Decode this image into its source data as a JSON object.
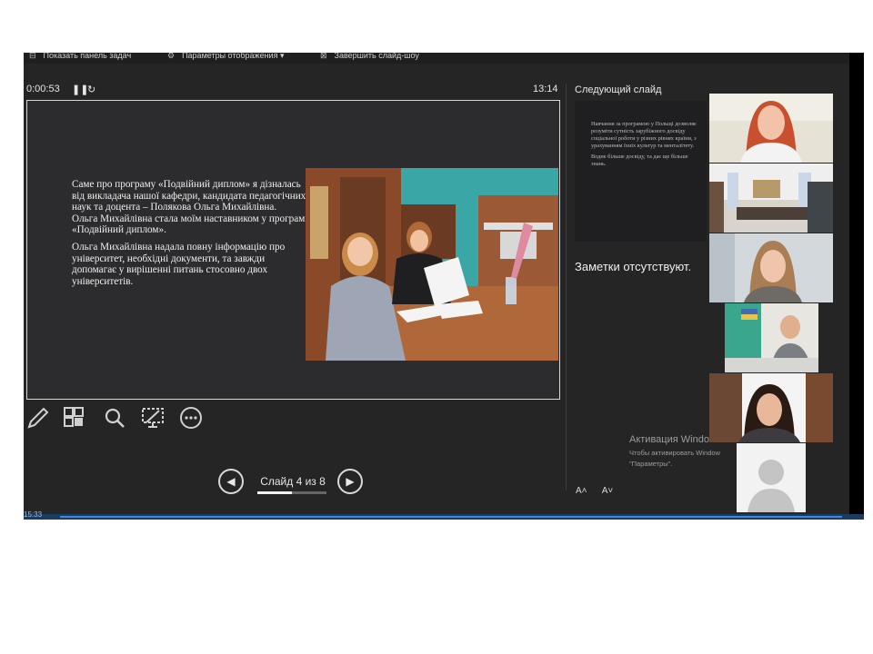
{
  "toolbar": {
    "show_taskbar": "Показать панель задач",
    "display_settings": "Параметры отображения ▾",
    "end_show": "Завершить слайд-шоу"
  },
  "presenter": {
    "elapsed": "0:00:53",
    "clock": "13:14",
    "slide_counter": "Слайд 4 из 8",
    "progress_fraction": 0.5
  },
  "slide": {
    "para1": "Саме про програму «Подвійний диплом» я дізналась від викладача нашої кафедри, кандидата педагогічних наук та доцента – Полякова Ольга Михайлівна.",
    "para2": "Ольга Михайлівна стала моїм наставником у програмі «Подвійний диплом».",
    "para3": "Ольга Михайлівна надала повну інформацію про університет, необхідні документи, та завжди допомагає у вирішенні питань стосовно двох університетів."
  },
  "next_slide": {
    "label": "Следующий слайд",
    "para1": "Навчання за програмою у Польщі дозволяє розуміти сутність зарубіжного досвіду соціальної роботи у різних рівнях країни, з урахуванням їхніх культур та менталітету.",
    "para2": "Водне більше досвіду, та дає ще більше знань."
  },
  "notes": {
    "text": "Заметки отсутствуют."
  },
  "activation": {
    "title": "Активация Windows",
    "line1": "Чтобы активировать Windows, перейдите в раздел",
    "line2": "\"Параметры\"."
  },
  "font_controls": {
    "increase": "A˄",
    "decrease": "A˅"
  },
  "taskbar": {
    "time": "15:33"
  },
  "icons": [
    "pen-icon",
    "slides-grid-icon",
    "zoom-icon",
    "screen-icon",
    "more-icon",
    "prev-arrow-icon",
    "next-arrow-icon"
  ]
}
